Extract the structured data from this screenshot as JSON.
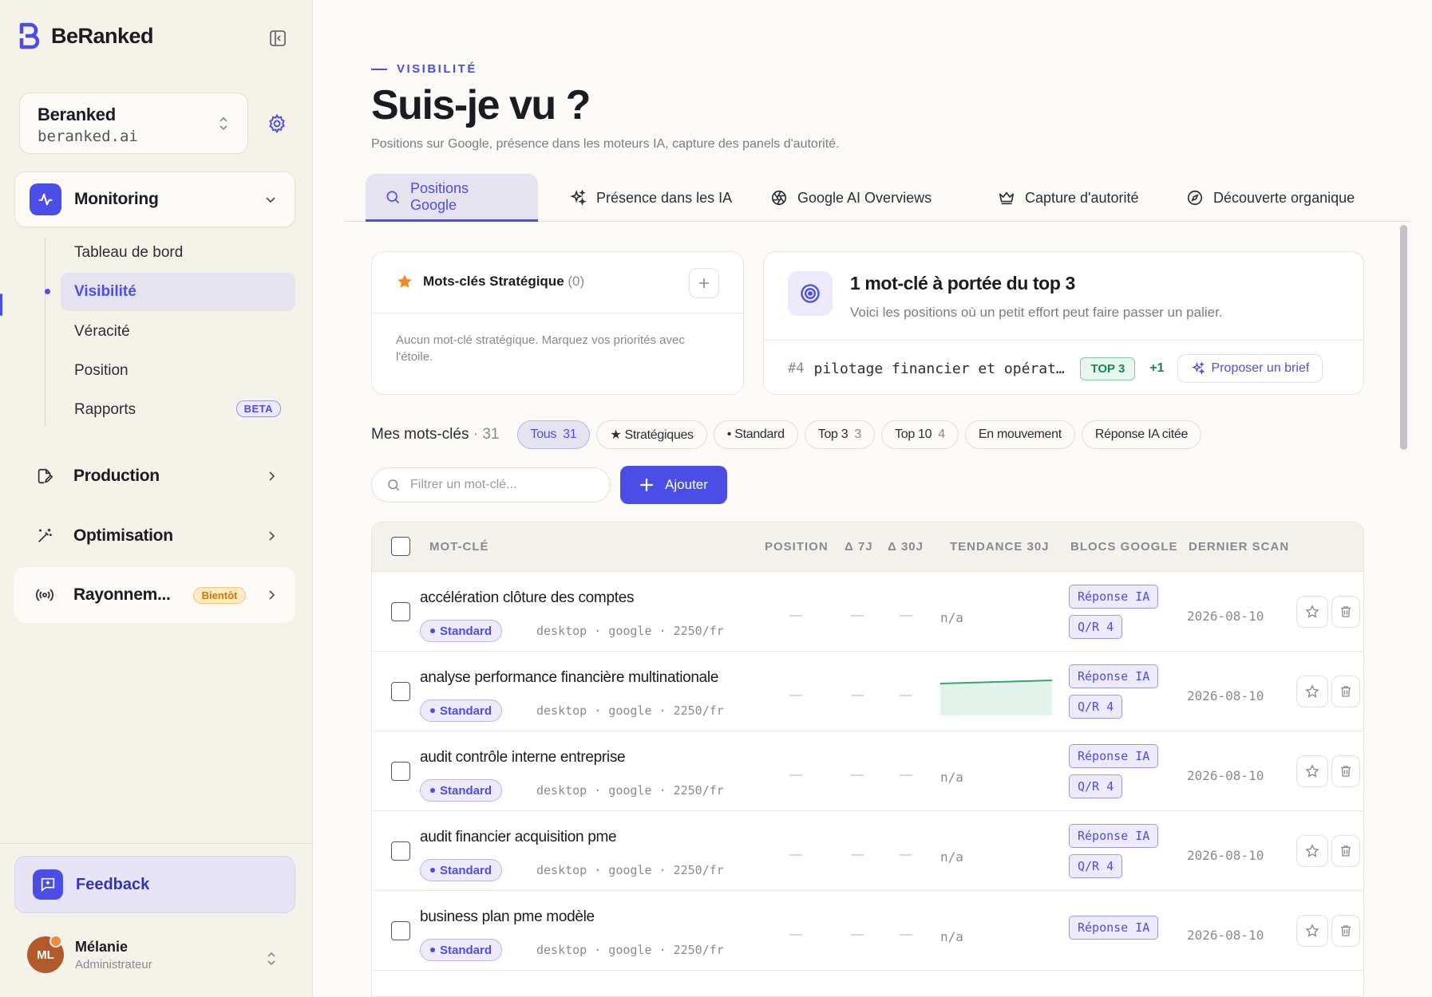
{
  "brand": {
    "name": "BeRanked",
    "logo_icon": "b-logo-icon",
    "color": "#4b4ee6"
  },
  "workspace": {
    "name": "Beranked",
    "domain": "beranked.ai"
  },
  "nav": {
    "monitoring": {
      "label": "Monitoring",
      "icon": "activity-icon"
    },
    "sub_items": [
      {
        "label": "Tableau de bord"
      },
      {
        "label": "Visibilité"
      },
      {
        "label": "Véracité"
      },
      {
        "label": "Position"
      },
      {
        "label": "Rapports",
        "badge": "BETA"
      }
    ],
    "production": {
      "label": "Production",
      "icon": "file-edit-icon"
    },
    "optimisation": {
      "label": "Optimisation",
      "icon": "magic-wand-icon"
    },
    "rayonnement": {
      "label": "Rayonnem...",
      "badge": "Bientôt",
      "icon": "broadcast-icon"
    }
  },
  "feedback": {
    "label": "Feedback"
  },
  "user": {
    "initials": "ML",
    "name": "Mélanie",
    "role": "Administrateur"
  },
  "page": {
    "eyebrow": "VISIBILITÉ",
    "title": "Suis-je vu ?",
    "subtitle": "Positions sur Google, présence dans les moteurs IA, capture des panels d'autorité."
  },
  "tabs": [
    {
      "label": "Positions Google",
      "icon": "search-icon",
      "active": true
    },
    {
      "label": "Présence dans les IA",
      "icon": "sparkles-icon",
      "active": false
    },
    {
      "label": "Google AI Overviews",
      "icon": "aperture-icon",
      "active": false
    },
    {
      "label": "Capture d'autorité",
      "icon": "crown-icon",
      "active": false
    },
    {
      "label": "Découverte organique",
      "icon": "compass-icon",
      "active": false
    }
  ],
  "strategic": {
    "title": "Mots-clés Stratégique",
    "count": "(0)",
    "empty": "Aucun mot-clé stratégique. Marquez vos priorités avec l'étoile."
  },
  "opportunity": {
    "title": "1 mot-clé à portée du top 3",
    "subtitle": "Voici les positions où un petit effort peut faire passer un palier.",
    "rank": "#4",
    "keyword": "pilotage financier et opérationnel",
    "badge": "TOP 3",
    "delta": "+1",
    "button": "Proposer un brief"
  },
  "filters": {
    "label": "Mes mots-clés",
    "count": "· 31",
    "chips": [
      {
        "label": "Tous",
        "count": "31",
        "active": true
      },
      {
        "label": "★ Stratégiques",
        "count": ""
      },
      {
        "label": "• Standard",
        "count": ""
      },
      {
        "label": "Top 3",
        "count": "3"
      },
      {
        "label": "Top 10",
        "count": "4"
      },
      {
        "label": "En mouvement",
        "count": ""
      },
      {
        "label": "Réponse IA citée",
        "count": ""
      }
    ]
  },
  "search": {
    "placeholder": "Filtrer un mot-clé..."
  },
  "add_button": {
    "label": "Ajouter"
  },
  "table": {
    "headers": {
      "keyword": "MOT-CLÉ",
      "position": "POSITION",
      "d7": "Δ 7J",
      "d30": "Δ 30J",
      "trend": "TENDANCE 30J",
      "blocks": "BLOCS GOOGLE",
      "scan": "DERNIER SCAN"
    },
    "rows": [
      {
        "keyword": "accélération clôture des comptes",
        "tag": "Standard",
        "meta": "desktop · google · 2250/fr",
        "position": "—",
        "d7": "—",
        "d30": "—",
        "trend": "n/a",
        "block1": "Réponse IA",
        "block2": "Q/R 4",
        "scan": "2026-08-10"
      },
      {
        "keyword": "analyse performance financière multinationale",
        "tag": "Standard",
        "meta": "desktop · google · 2250/fr",
        "position": "—",
        "d7": "—",
        "d30": "—",
        "trend": "",
        "block1": "Réponse IA",
        "block2": "Q/R 4",
        "scan": "2026-08-10"
      },
      {
        "keyword": "audit contrôle interne entreprise",
        "tag": "Standard",
        "meta": "desktop · google · 2250/fr",
        "position": "—",
        "d7": "—",
        "d30": "—",
        "trend": "n/a",
        "block1": "Réponse IA",
        "block2": "Q/R 4",
        "scan": "2026-08-10"
      },
      {
        "keyword": "audit financier acquisition pme",
        "tag": "Standard",
        "meta": "desktop · google · 2250/fr",
        "position": "—",
        "d7": "—",
        "d30": "—",
        "trend": "n/a",
        "block1": "Réponse IA",
        "block2": "Q/R 4",
        "scan": "2026-08-10"
      },
      {
        "keyword": "business plan pme modèle",
        "tag": "Standard",
        "meta": "desktop · google · 2250/fr",
        "position": "—",
        "d7": "—",
        "d30": "—",
        "trend": "n/a",
        "block1": "Réponse IA",
        "block2": "",
        "scan": "2026-08-10"
      }
    ]
  },
  "colors": {
    "accent": "#4b4ee6",
    "success": "#198555",
    "warning": "#c87800"
  }
}
